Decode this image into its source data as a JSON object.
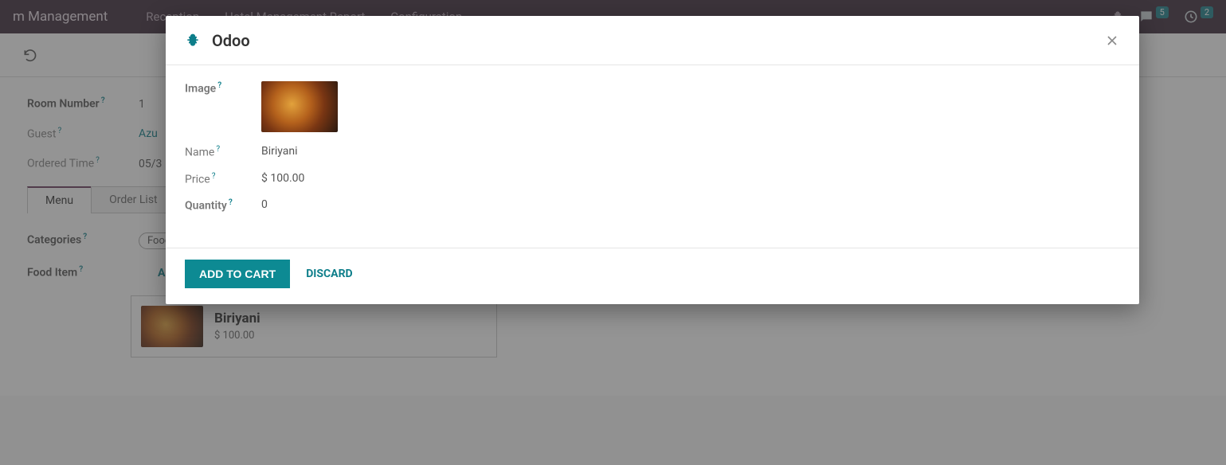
{
  "topnav": {
    "app_title": "m Management",
    "items": [
      "Reception",
      "Hotel Management Report",
      "Configuration"
    ],
    "chat_count": "5",
    "clock_count": "2"
  },
  "form": {
    "room_number_label": "Room Number",
    "room_number_value": "1",
    "guest_label": "Guest",
    "guest_value": "Azu",
    "ordered_time_label": "Ordered Time",
    "ordered_time_value": "05/3"
  },
  "tabs": {
    "menu": "Menu",
    "order_list": "Order List"
  },
  "categories": {
    "label": "Categories",
    "chip_text": "Food",
    "chip_x": "×"
  },
  "food_item": {
    "label": "Food Item",
    "add": "ADD"
  },
  "card": {
    "name": "Biriyani",
    "price": "$ 100.00"
  },
  "modal": {
    "title": "Odoo",
    "image_label": "Image",
    "name_label": "Name",
    "name_value": "Biriyani",
    "price_label": "Price",
    "price_value": "$ 100.00",
    "quantity_label": "Quantity",
    "quantity_value": "0",
    "add_to_cart": "ADD TO CART",
    "discard": "DISCARD"
  },
  "help_q": "?"
}
